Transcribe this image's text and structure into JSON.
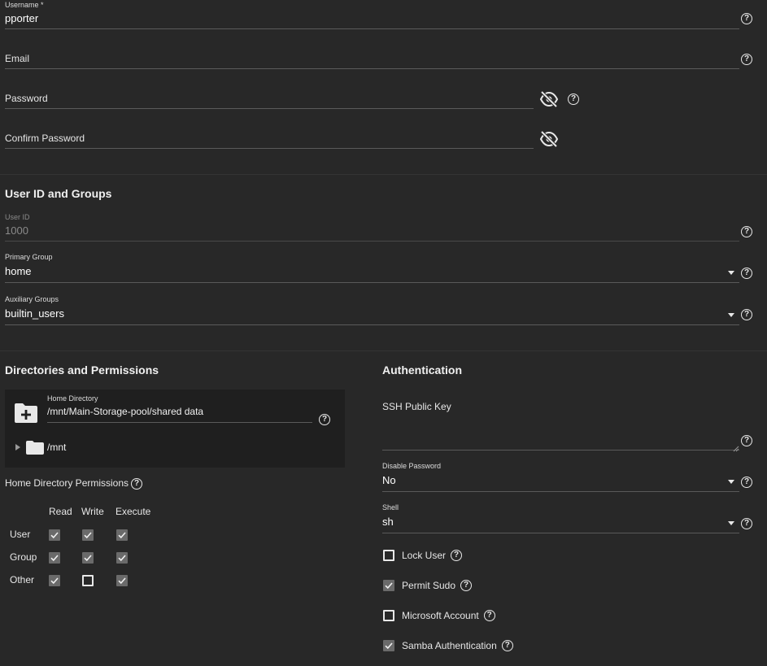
{
  "identity": {
    "username": {
      "label": "Username *",
      "value": "pporter"
    },
    "email": {
      "label": "Email"
    },
    "password": {
      "label": "Password"
    },
    "confirm_password": {
      "label": "Confirm Password"
    }
  },
  "user_id_groups": {
    "title": "User ID and Groups",
    "user_id": {
      "label": "User ID",
      "value": "1000"
    },
    "primary_group": {
      "label": "Primary Group",
      "value": "home"
    },
    "auxiliary_groups": {
      "label": "Auxiliary Groups",
      "value": "builtin_users"
    }
  },
  "directories": {
    "title": "Directories and Permissions",
    "home_directory": {
      "label": "Home Directory",
      "value": "/mnt/Main-Storage-pool/shared data"
    },
    "tree_root": "/mnt",
    "permissions_label": "Home Directory Permissions",
    "columns": [
      "Read",
      "Write",
      "Execute"
    ],
    "rows": [
      {
        "label": "User",
        "checks": [
          true,
          true,
          true
        ]
      },
      {
        "label": "Group",
        "checks": [
          true,
          true,
          true
        ]
      },
      {
        "label": "Other",
        "checks": [
          true,
          false,
          true
        ]
      }
    ]
  },
  "authentication": {
    "title": "Authentication",
    "ssh_key": {
      "label": "SSH Public Key"
    },
    "disable_password": {
      "label": "Disable Password",
      "value": "No"
    },
    "shell": {
      "label": "Shell",
      "value": "sh"
    },
    "options": [
      {
        "label": "Lock User",
        "checked": false
      },
      {
        "label": "Permit Sudo",
        "checked": true
      },
      {
        "label": "Microsoft Account",
        "checked": false
      },
      {
        "label": "Samba Authentication",
        "checked": true
      }
    ]
  },
  "icons": {
    "help": "help-circle-icon",
    "visibility": "eye-off-icon",
    "dropdown": "caret-down-icon",
    "folder_add": "folder-plus-icon",
    "folder": "folder-icon",
    "tree_toggle": "triangle-right-icon",
    "checkbox_checked": "check-icon"
  },
  "colors": {
    "background": "#282828",
    "explorer_background": "#1f1f1f",
    "checkbox_fill": "#6a6a6a",
    "underline": "#5a5a5a"
  }
}
